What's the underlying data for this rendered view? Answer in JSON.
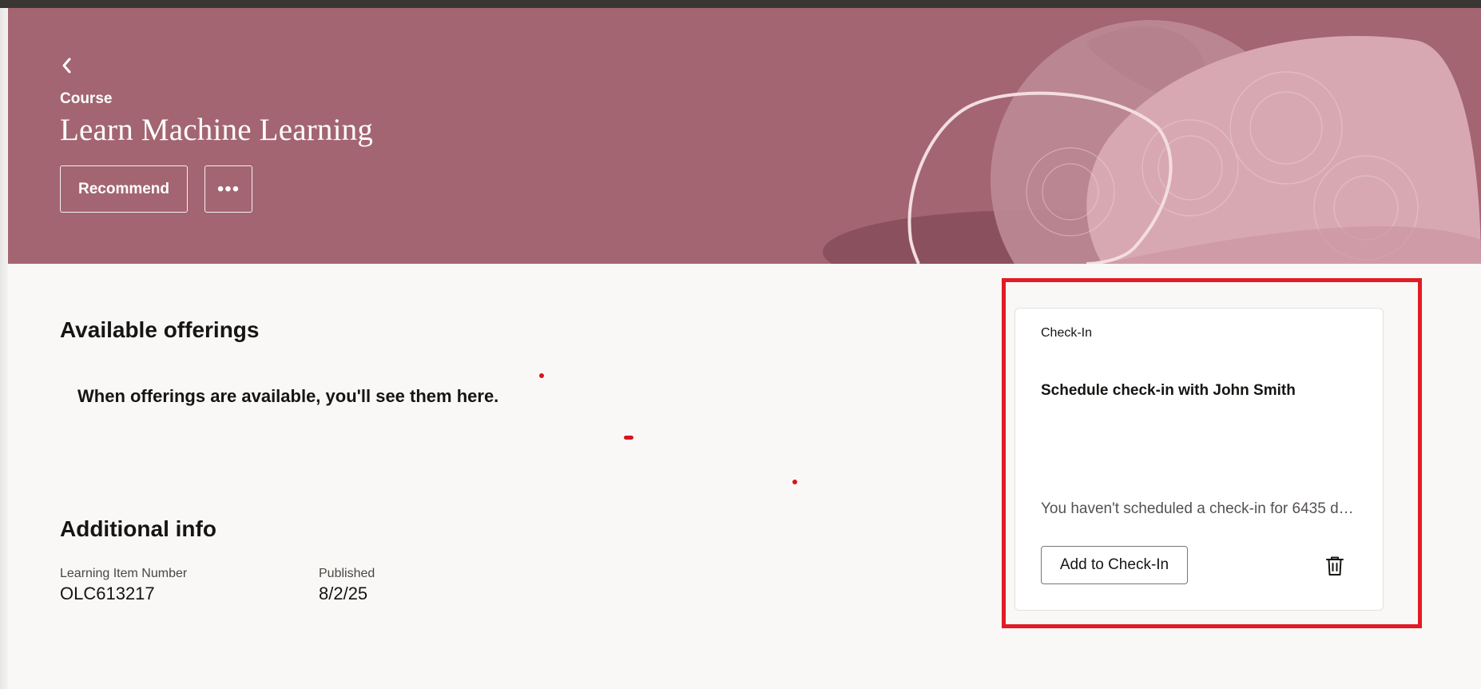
{
  "header": {
    "eyebrow": "Course",
    "title": "Learn Machine Learning",
    "recommend_label": "Recommend",
    "more_label": "•••",
    "background_color": "#a36571"
  },
  "offerings": {
    "heading": "Available offerings",
    "empty_message": "When offerings are available, you'll see them here."
  },
  "additional_info": {
    "heading": "Additional info",
    "fields": [
      {
        "label": "Learning Item Number",
        "value": "OLC613217"
      },
      {
        "label": "Published",
        "value": "8/2/25"
      }
    ]
  },
  "checkin_card": {
    "type_label": "Check-In",
    "title": "Schedule check-in with John Smith",
    "description": "You haven't scheduled a check-in for 6435 d…",
    "add_button_label": "Add to Check-In",
    "highlight_color": "#e21b25"
  },
  "icons": {
    "back": "chevron-left-icon",
    "more": "more-horizontal-icon",
    "delete": "trash-icon"
  }
}
